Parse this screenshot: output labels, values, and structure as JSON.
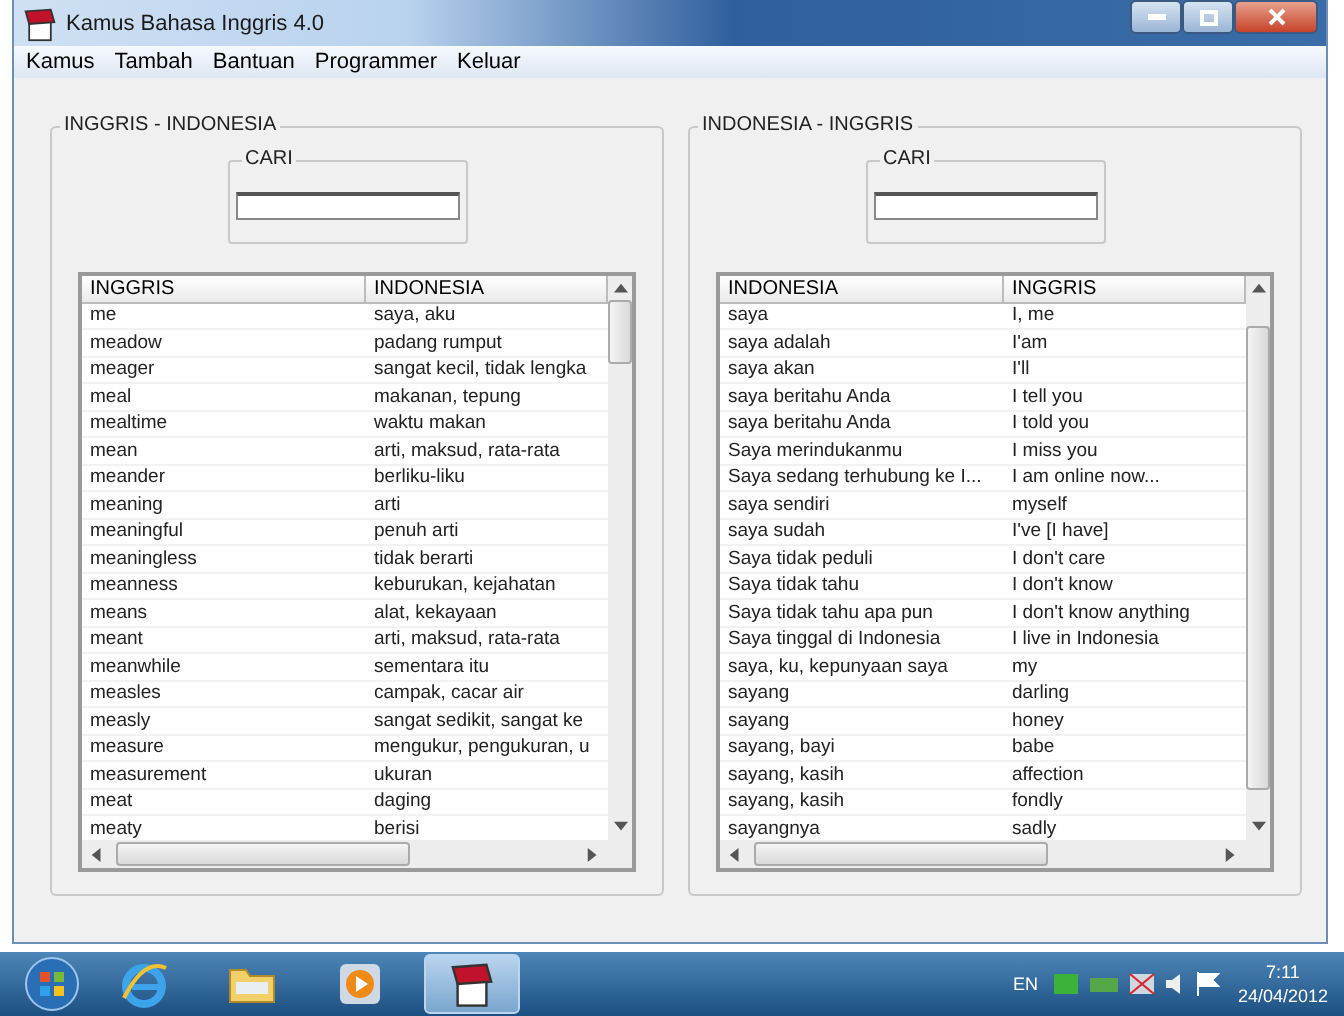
{
  "window": {
    "title": "Kamus Bahasa Inggris 4.0"
  },
  "menu": [
    "Kamus",
    "Tambah",
    "Bantuan",
    "Programmer",
    "Keluar"
  ],
  "panels": [
    {
      "title": "INGGRIS - INDONESIA",
      "search": {
        "label": "CARI"
      },
      "columns": [
        "INGGRIS",
        "INDONESIA"
      ],
      "rows": [
        [
          "me",
          "saya, aku"
        ],
        [
          "meadow",
          "padang rumput"
        ],
        [
          "meager",
          "sangat kecil, tidak lengka"
        ],
        [
          "meal",
          "makanan, tepung"
        ],
        [
          "mealtime",
          "waktu makan"
        ],
        [
          "mean",
          "arti, maksud, rata-rata"
        ],
        [
          "meander",
          "berliku-liku"
        ],
        [
          "meaning",
          "arti"
        ],
        [
          "meaningful",
          "penuh arti"
        ],
        [
          "meaningless",
          "tidak berarti"
        ],
        [
          "meanness",
          "keburukan, kejahatan"
        ],
        [
          "means",
          "alat, kekayaan"
        ],
        [
          "meant",
          "arti, maksud, rata-rata"
        ],
        [
          "meanwhile",
          "sementara itu"
        ],
        [
          "measles",
          "campak, cacar air"
        ],
        [
          "measly",
          "sangat sedikit, sangat ke"
        ],
        [
          "measure",
          "mengukur, pengukuran, u"
        ],
        [
          "measurement",
          "ukuran"
        ],
        [
          "meat",
          "daging"
        ],
        [
          "meaty",
          "berisi"
        ]
      ]
    },
    {
      "title": "INDONESIA - INGGRIS",
      "search": {
        "label": "CARI"
      },
      "columns": [
        "INDONESIA",
        "INGGRIS"
      ],
      "rows": [
        [
          "saya",
          "I, me"
        ],
        [
          "saya adalah",
          "I'am"
        ],
        [
          "saya akan",
          "I'll"
        ],
        [
          "saya beritahu Anda",
          "I tell you"
        ],
        [
          "saya beritahu Anda",
          "I told you"
        ],
        [
          "Saya merindukanmu",
          "I miss you"
        ],
        [
          "Saya sedang terhubung ke I...",
          "I am online now..."
        ],
        [
          "saya sendiri",
          "myself"
        ],
        [
          "saya sudah",
          "I've [I have]"
        ],
        [
          "Saya tidak peduli",
          "I don't care"
        ],
        [
          "Saya tidak tahu",
          "I don't know"
        ],
        [
          "Saya tidak tahu apa pun",
          "I don't know anything"
        ],
        [
          "Saya tinggal di Indonesia",
          "I live in Indonesia"
        ],
        [
          "saya, ku, kepunyaan saya",
          "my"
        ],
        [
          "sayang",
          "darling"
        ],
        [
          "sayang",
          "honey"
        ],
        [
          "sayang, bayi",
          "babe"
        ],
        [
          "sayang, kasih",
          "affection"
        ],
        [
          "sayang, kasih",
          "fondly"
        ],
        [
          "sayangnya",
          "sadly"
        ]
      ]
    }
  ],
  "taskbar": {
    "apps": [
      {
        "kind": "browser",
        "selected": false
      },
      {
        "kind": "folder",
        "selected": false
      },
      {
        "kind": "media",
        "selected": false
      },
      {
        "kind": "app",
        "selected": true
      }
    ],
    "language": "EN",
    "time": "7:11",
    "date": "24/04/2012"
  }
}
